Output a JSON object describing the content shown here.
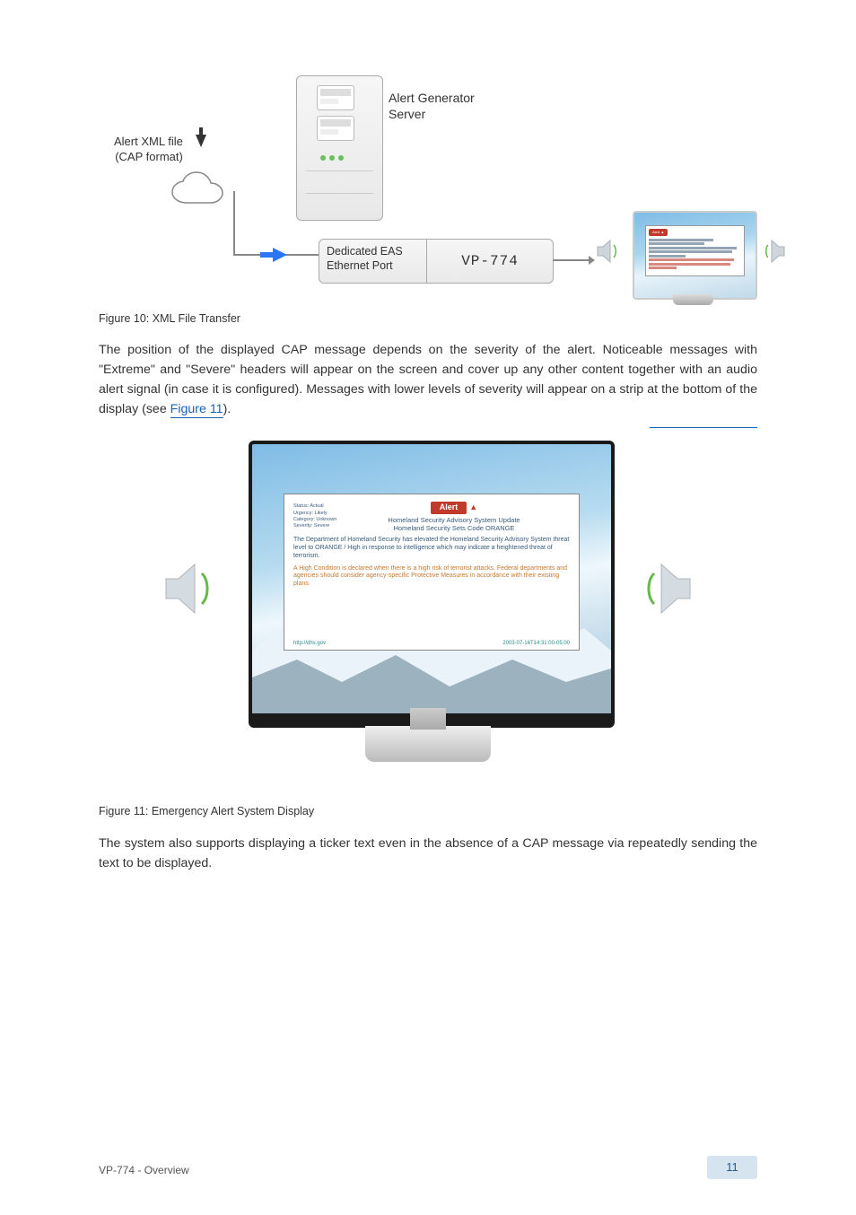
{
  "figure_top": {
    "server_label_line1": "Alert Generator",
    "server_label_line2": "Server",
    "xml_label_line1": "Alert XML file",
    "xml_label_line2": "(CAP format)",
    "eas_port_line1": "Dedicated EAS",
    "eas_port_line2": "Ethernet Port",
    "device_name": "VP-774"
  },
  "figure_top_caption": "Figure 10: XML File Transfer",
  "para1": "The position of the displayed CAP message depends on the severity of the alert. Noticeable messages with \"Extreme\" and \"Severe\" headers will appear on the screen and cover up any other content together with an audio alert signal (in case it is configured). Messages with lower levels of severity will appear on a strip at the bottom of the display (see",
  "para1_tail": ").",
  "figure_main_link": "Figure 11",
  "section_link_wrap_note": "",
  "alert_box": {
    "tag": "Alert",
    "status_lines": [
      "Status: Actual",
      "Urgency: Likely",
      "Category: Unknown",
      "Severity: Severe"
    ],
    "headline1": "Homeland Security Advisory System Update",
    "headline2": "Homeland Security Sets Code ORANGE",
    "p1": "The Department of Homeland Security has elevated the Homeland Security Advisory System threat level to ORANGE / High in response to intelligence which may indicate a heightened threat of terrorism.",
    "p2": "A High Condition is declared when there is a high risk of terrorist attacks. Federal departments and agencies should consider agency-specific Protective Measures in accordance with their existing plans.",
    "foot_left": "http://dhs.gov",
    "foot_right": "2003-07-16T14:31:00-05:00"
  },
  "figure_main_caption": "Figure 11: Emergency Alert System Display",
  "para2": "The system also supports displaying a ticker text even in the absence of a CAP message via repeatedly sending the text to be displayed.",
  "footer": {
    "product": "VP-774 - Overview",
    "page": "11"
  }
}
